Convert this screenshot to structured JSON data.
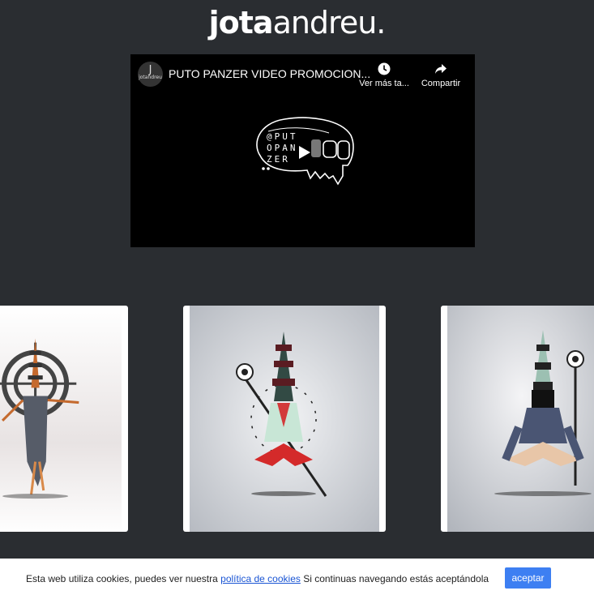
{
  "logo": {
    "bold_part": "jota",
    "light_part": "andreu."
  },
  "video": {
    "channel_label": "jotandreu",
    "title": "PUTO PANZER VIDEO PROMOCION...",
    "watch_later_label": "Ver más ta...",
    "share_label": "Compartir",
    "overlay_text": [
      "@PUT",
      "OPAN",
      "ZER"
    ]
  },
  "gallery": {
    "items": [
      {
        "name": "artwork-left"
      },
      {
        "name": "artwork-center"
      },
      {
        "name": "artwork-right"
      }
    ]
  },
  "cookie_bar": {
    "text_before": "Esta web utiliza cookies, puedes ver nuestra ",
    "link_text": "política de cookies",
    "text_after": " Si continuas navegando estás aceptándola",
    "accept_label": "aceptar"
  },
  "colors": {
    "background": "#2a2d31",
    "accent": "#3d7ff2",
    "link": "#1a55d4"
  }
}
